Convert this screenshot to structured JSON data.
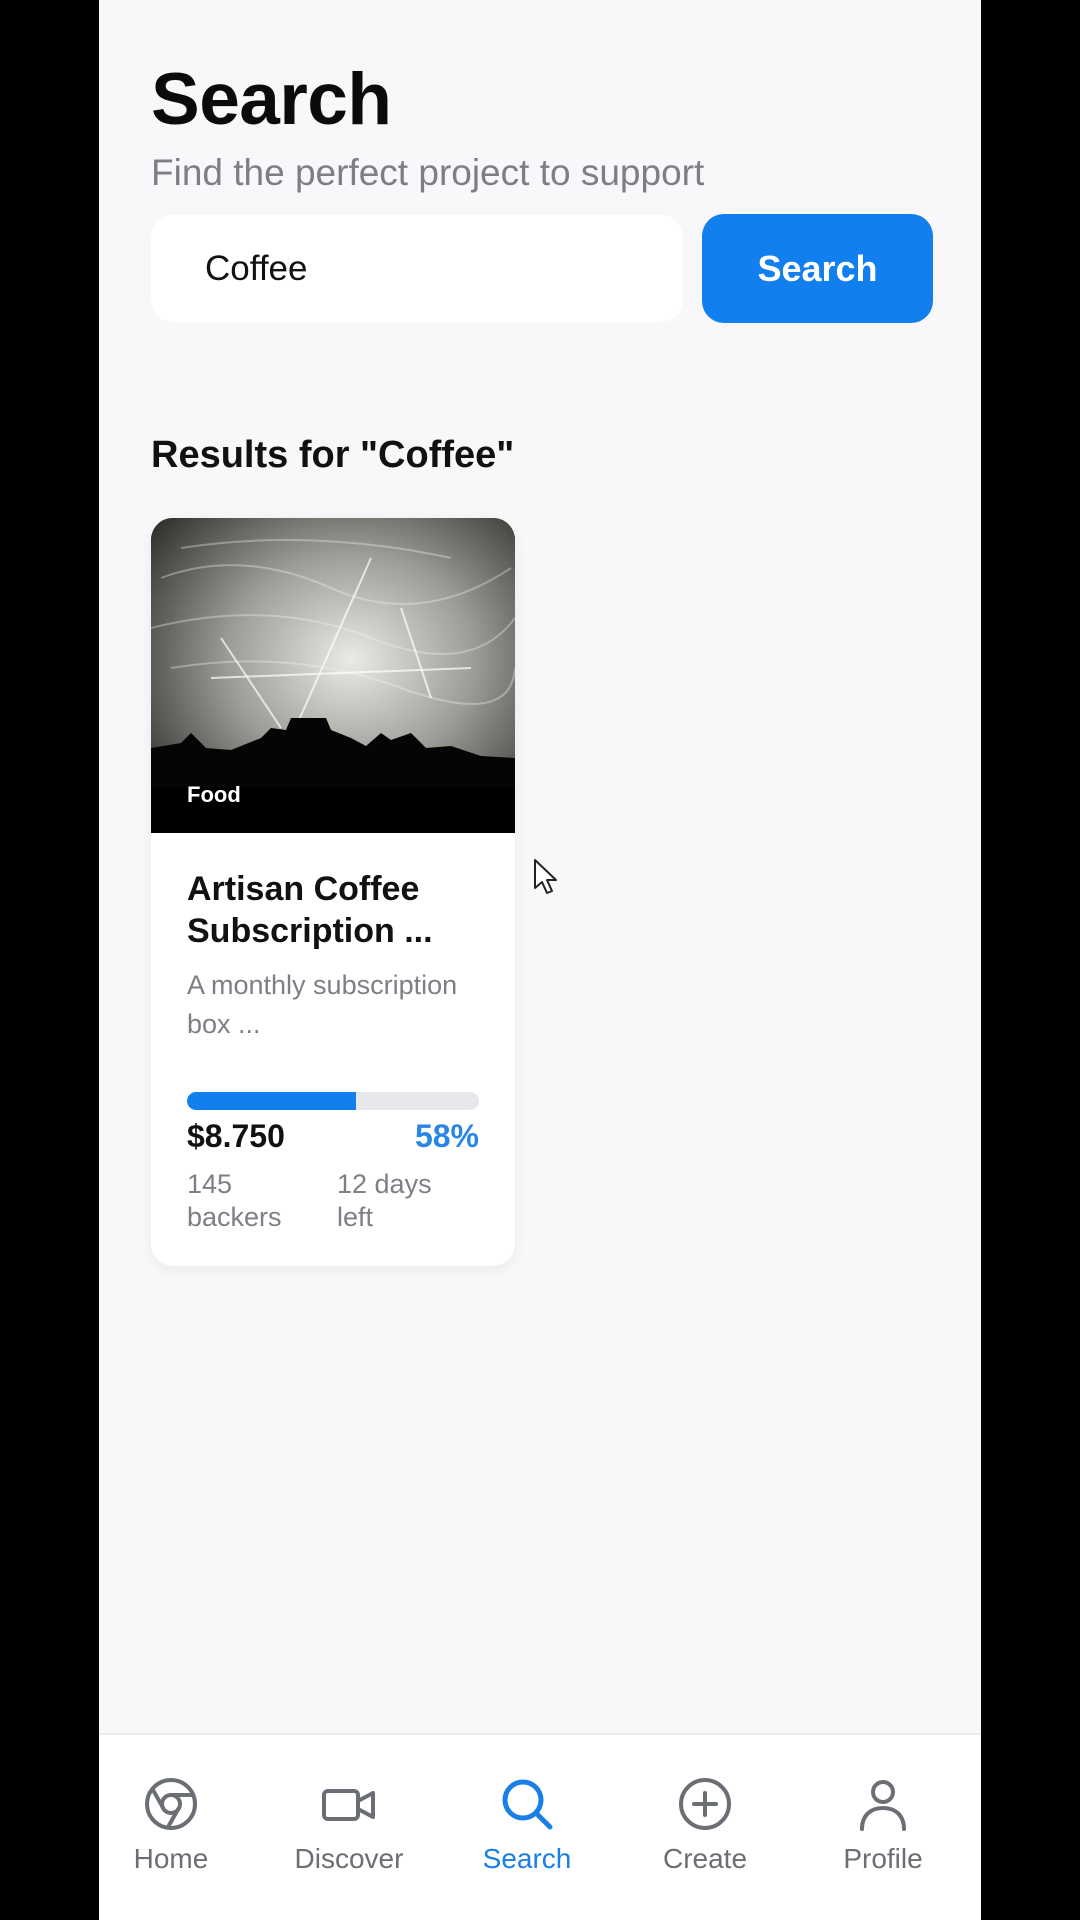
{
  "header": {
    "title": "Search",
    "subtitle": "Find the perfect project to support"
  },
  "search": {
    "value": "Coffee",
    "button_label": "Search"
  },
  "results": {
    "heading": "Results for \"Coffee\"",
    "items": [
      {
        "category": "Food",
        "title": "Artisan Coffee Subscription ...",
        "description": "A monthly subscription box ...",
        "amount": "$8.750",
        "percent_label": "58%",
        "progress": 0.58,
        "backers": "145 backers",
        "days_left": "12 days left"
      }
    ]
  },
  "nav": {
    "items": [
      {
        "label": "Home",
        "icon": "chrome-icon",
        "active": false
      },
      {
        "label": "Discover",
        "icon": "video-icon",
        "active": false
      },
      {
        "label": "Search",
        "icon": "search-icon",
        "active": true
      },
      {
        "label": "Create",
        "icon": "plus-circle-icon",
        "active": false
      },
      {
        "label": "Profile",
        "icon": "user-icon",
        "active": false
      }
    ]
  },
  "colors": {
    "accent": "#1180ee",
    "background": "#f8f8fa",
    "muted_text": "#7d7f86"
  }
}
